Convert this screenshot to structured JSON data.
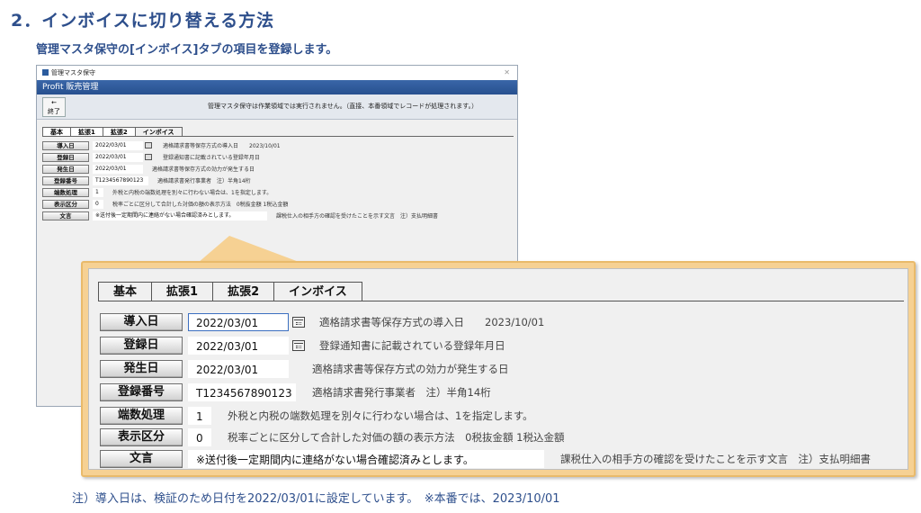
{
  "heading": "2．インボイスに切り替える方法",
  "subheading": "管理マスタ保守の[インボイス]タブの項目を登録します。",
  "window": {
    "title": "管理マスタ保守",
    "app_title": "Profit 販売管理",
    "back_arrow": "←",
    "back_label": "終了",
    "message": "管理マスタ保守は作業領域では実行されません。（直接、本番領域でレコードが処理されます。）"
  },
  "tabs": [
    "基本",
    "拡張1",
    "拡張2",
    "インボイス"
  ],
  "active_tab": "インボイス",
  "fields": [
    {
      "label": "導入日",
      "value": "2022/03/01",
      "calendar": true,
      "desc": "適格請求書等保存方式の導入日　　2023/10/01"
    },
    {
      "label": "登録日",
      "value": "2022/03/01",
      "calendar": true,
      "desc": "登録通知書に記載されている登録年月日"
    },
    {
      "label": "発生日",
      "value": "2022/03/01",
      "calendar": false,
      "desc": "適格請求書等保存方式の効力が発生する日"
    },
    {
      "label": "登録番号",
      "value": "T1234567890123",
      "calendar": false,
      "desc": "適格請求書発行事業者　注）半角14桁"
    },
    {
      "label": "端数処理",
      "value": "1",
      "calendar": false,
      "desc": "外税と内税の端数処理を別々に行わない場合は、1を指定します。"
    },
    {
      "label": "表示区分",
      "value": "0",
      "calendar": false,
      "desc": "税率ごとに区分して合計した対価の額の表示方法　0税抜金額  1税込金額"
    },
    {
      "label": "文言",
      "value": "※送付後一定期間内に連絡がない場合確認済みとします。",
      "calendar": false,
      "desc": "課税仕入の相手方の確認を受けたことを示す文言　注）支払明細書"
    }
  ],
  "note": "注）導入日は、検証のため日付を2022/03/01に設定しています。　※本番では、2023/10/01",
  "colors": {
    "accent": "#2e4f8c",
    "callout": "#f6d193",
    "titlebar": "#27508f"
  }
}
